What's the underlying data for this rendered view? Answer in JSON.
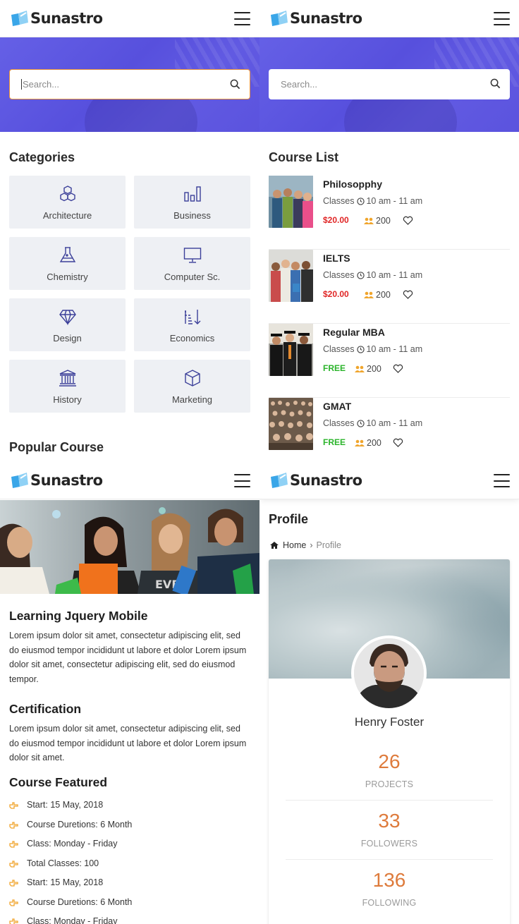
{
  "brand": {
    "name": "Sunastro"
  },
  "search": {
    "placeholder": "Search..."
  },
  "categories": {
    "title": "Categories",
    "items": [
      {
        "label": "Architecture",
        "icon": "cubes-icon"
      },
      {
        "label": "Business",
        "icon": "bar-chart-icon"
      },
      {
        "label": "Chemistry",
        "icon": "flask-icon"
      },
      {
        "label": "Computer Sc.",
        "icon": "monitor-icon"
      },
      {
        "label": "Design",
        "icon": "diamond-icon"
      },
      {
        "label": "Economics",
        "icon": "sort-amount-icon"
      },
      {
        "label": "History",
        "icon": "bank-icon"
      },
      {
        "label": "Marketing",
        "icon": "box-icon"
      }
    ]
  },
  "popular": {
    "title": "Popular Course"
  },
  "course_list": {
    "title": "Course List",
    "items": [
      {
        "name": "Philosopphy",
        "classes_label": "Classes",
        "time": "10 am - 11 am",
        "price": "$20.00",
        "price_type": "paid",
        "students": "200"
      },
      {
        "name": "IELTS",
        "classes_label": "Classes",
        "time": "10 am - 11 am",
        "price": "$20.00",
        "price_type": "paid",
        "students": "200"
      },
      {
        "name": "Regular MBA",
        "classes_label": "Classes",
        "time": "10 am - 11 am",
        "price": "FREE",
        "price_type": "free",
        "students": "200"
      },
      {
        "name": "GMAT",
        "classes_label": "Classes",
        "time": "10 am - 11 am",
        "price": "FREE",
        "price_type": "free",
        "students": "200"
      }
    ]
  },
  "detail": {
    "title": "Learning Jquery Mobile",
    "intro": "Lorem ipsum dolor sit amet, consectetur adipiscing elit, sed do eiusmod tempor incididunt ut labore et dolor Lorem ipsum dolor sit amet, consectetur adipiscing elit, sed do eiusmod tempor.",
    "certification_title": "Certification",
    "certification_text": "Lorem ipsum dolor sit amet, consectetur adipiscing elit, sed do eiusmod tempor incididunt ut labore et dolor Lorem ipsum dolor sit amet.",
    "featured_title": "Course Featured",
    "featured": [
      "Start: 15 May, 2018",
      "Course Duretions: 6 Month",
      "Class: Monday - Friday",
      "Total Classes: 100",
      "Start: 15 May, 2018",
      "Course Duretions: 6 Month",
      "Class: Monday - Friday"
    ]
  },
  "profile": {
    "title": "Profile",
    "breadcrumb_home": "Home",
    "breadcrumb_current": "Profile",
    "name": "Henry Foster",
    "stats": [
      {
        "value": "26",
        "label": "PROJECTS"
      },
      {
        "value": "33",
        "label": "FOLLOWERS"
      },
      {
        "value": "136",
        "label": "FOLLOWING"
      }
    ]
  },
  "colors": {
    "accent": "#5a53dd",
    "stat": "#de7b3c",
    "price_paid": "#e02626",
    "price_free": "#2bb42b",
    "icon": "#3b3f99",
    "bullet": "#f0a52c"
  }
}
